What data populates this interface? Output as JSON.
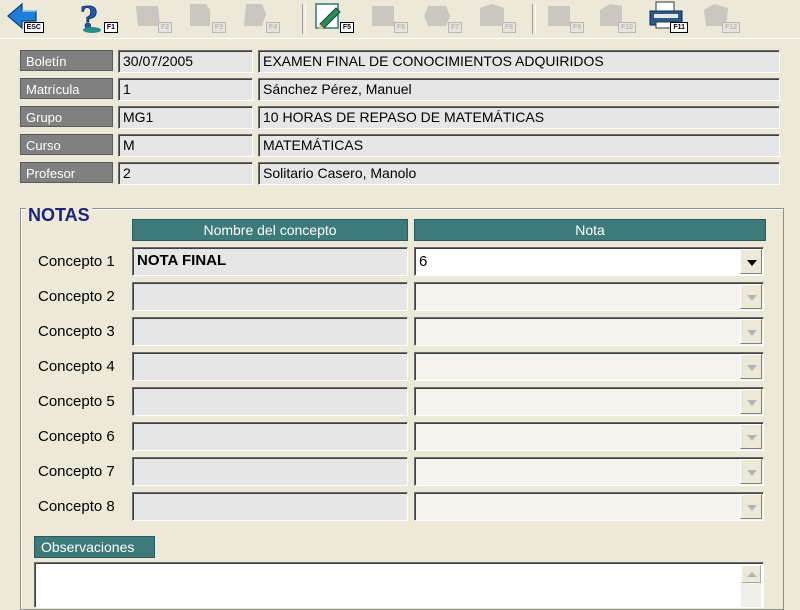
{
  "toolbar": {
    "buttons": [
      {
        "id": "esc",
        "key": "ESC",
        "icon": "back-arrow-icon",
        "enabled": true
      },
      {
        "id": "f1",
        "key": "F1",
        "icon": "help-icon",
        "enabled": true
      },
      {
        "id": "f2",
        "key": "F2",
        "icon": "disabled-icon",
        "enabled": false
      },
      {
        "id": "f3",
        "key": "F3",
        "icon": "disabled-icon",
        "enabled": false
      },
      {
        "id": "f4",
        "key": "F4",
        "icon": "disabled-icon",
        "enabled": false
      },
      {
        "id": "f5",
        "key": "F5",
        "icon": "edit-pencil-icon",
        "enabled": true
      },
      {
        "id": "f6",
        "key": "F6",
        "icon": "disabled-icon",
        "enabled": false
      },
      {
        "id": "f7",
        "key": "F7",
        "icon": "disabled-icon",
        "enabled": false
      },
      {
        "id": "f8",
        "key": "F8",
        "icon": "disabled-icon",
        "enabled": false
      },
      {
        "id": "f9",
        "key": "F9",
        "icon": "disabled-icon",
        "enabled": false
      },
      {
        "id": "f10",
        "key": "F10",
        "icon": "disabled-icon",
        "enabled": false
      },
      {
        "id": "f11",
        "key": "F11",
        "icon": "printer-icon",
        "enabled": true
      },
      {
        "id": "f12",
        "key": "F12",
        "icon": "disabled-icon",
        "enabled": false
      }
    ]
  },
  "header": {
    "boletin": {
      "label": "Boletín",
      "code": "30/07/2005",
      "text": "EXAMEN FINAL DE CONOCIMIENTOS ADQUIRIDOS"
    },
    "matricula": {
      "label": "Matrícula",
      "code": "1",
      "text": "Sánchez Pérez, Manuel"
    },
    "grupo": {
      "label": "Grupo",
      "code": "MG1",
      "text": "10 HORAS DE REPASO DE MATEMÁTICAS"
    },
    "curso": {
      "label": "Curso",
      "code": "M",
      "text": "MATEMÁTICAS"
    },
    "profesor": {
      "label": "Profesor",
      "code": "2",
      "text": "Solitario Casero, Manolo"
    }
  },
  "notas": {
    "title": "NOTAS",
    "col_concept": "Nombre del concepto",
    "col_nota": "Nota",
    "rows": [
      {
        "label": "Concepto 1",
        "name": "NOTA FINAL",
        "nota": "6",
        "enabled": true
      },
      {
        "label": "Concepto 2",
        "name": "",
        "nota": "",
        "enabled": false
      },
      {
        "label": "Concepto 3",
        "name": "",
        "nota": "",
        "enabled": false
      },
      {
        "label": "Concepto 4",
        "name": "",
        "nota": "",
        "enabled": false
      },
      {
        "label": "Concepto 5",
        "name": "",
        "nota": "",
        "enabled": false
      },
      {
        "label": "Concepto 6",
        "name": "",
        "nota": "",
        "enabled": false
      },
      {
        "label": "Concepto 7",
        "name": "",
        "nota": "",
        "enabled": false
      },
      {
        "label": "Concepto 8",
        "name": "",
        "nota": "",
        "enabled": false
      }
    ]
  },
  "observaciones": {
    "label": "Observaciones",
    "value": ""
  },
  "colors": {
    "header_label_bg": "#808080",
    "column_header_bg": "#3d7a7a",
    "group_title": "#1a237e",
    "window_bg": "#ece9d8"
  }
}
